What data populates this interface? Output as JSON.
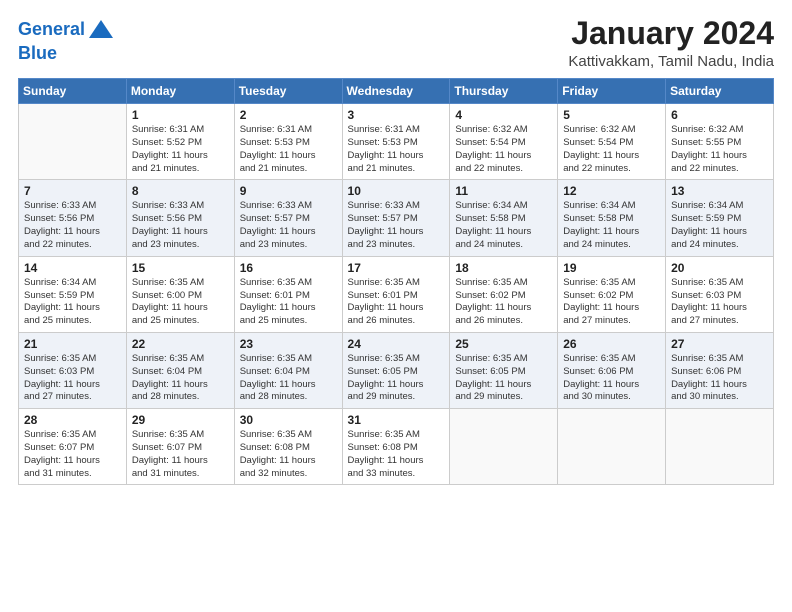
{
  "header": {
    "logo_line1": "General",
    "logo_line2": "Blue",
    "month": "January 2024",
    "location": "Kattivakkam, Tamil Nadu, India"
  },
  "weekdays": [
    "Sunday",
    "Monday",
    "Tuesday",
    "Wednesday",
    "Thursday",
    "Friday",
    "Saturday"
  ],
  "weeks": [
    [
      {
        "day": "",
        "info": ""
      },
      {
        "day": "1",
        "info": "Sunrise: 6:31 AM\nSunset: 5:52 PM\nDaylight: 11 hours\nand 21 minutes."
      },
      {
        "day": "2",
        "info": "Sunrise: 6:31 AM\nSunset: 5:53 PM\nDaylight: 11 hours\nand 21 minutes."
      },
      {
        "day": "3",
        "info": "Sunrise: 6:31 AM\nSunset: 5:53 PM\nDaylight: 11 hours\nand 21 minutes."
      },
      {
        "day": "4",
        "info": "Sunrise: 6:32 AM\nSunset: 5:54 PM\nDaylight: 11 hours\nand 22 minutes."
      },
      {
        "day": "5",
        "info": "Sunrise: 6:32 AM\nSunset: 5:54 PM\nDaylight: 11 hours\nand 22 minutes."
      },
      {
        "day": "6",
        "info": "Sunrise: 6:32 AM\nSunset: 5:55 PM\nDaylight: 11 hours\nand 22 minutes."
      }
    ],
    [
      {
        "day": "7",
        "info": "Sunrise: 6:33 AM\nSunset: 5:56 PM\nDaylight: 11 hours\nand 22 minutes."
      },
      {
        "day": "8",
        "info": "Sunrise: 6:33 AM\nSunset: 5:56 PM\nDaylight: 11 hours\nand 23 minutes."
      },
      {
        "day": "9",
        "info": "Sunrise: 6:33 AM\nSunset: 5:57 PM\nDaylight: 11 hours\nand 23 minutes."
      },
      {
        "day": "10",
        "info": "Sunrise: 6:33 AM\nSunset: 5:57 PM\nDaylight: 11 hours\nand 23 minutes."
      },
      {
        "day": "11",
        "info": "Sunrise: 6:34 AM\nSunset: 5:58 PM\nDaylight: 11 hours\nand 24 minutes."
      },
      {
        "day": "12",
        "info": "Sunrise: 6:34 AM\nSunset: 5:58 PM\nDaylight: 11 hours\nand 24 minutes."
      },
      {
        "day": "13",
        "info": "Sunrise: 6:34 AM\nSunset: 5:59 PM\nDaylight: 11 hours\nand 24 minutes."
      }
    ],
    [
      {
        "day": "14",
        "info": "Sunrise: 6:34 AM\nSunset: 5:59 PM\nDaylight: 11 hours\nand 25 minutes."
      },
      {
        "day": "15",
        "info": "Sunrise: 6:35 AM\nSunset: 6:00 PM\nDaylight: 11 hours\nand 25 minutes."
      },
      {
        "day": "16",
        "info": "Sunrise: 6:35 AM\nSunset: 6:01 PM\nDaylight: 11 hours\nand 25 minutes."
      },
      {
        "day": "17",
        "info": "Sunrise: 6:35 AM\nSunset: 6:01 PM\nDaylight: 11 hours\nand 26 minutes."
      },
      {
        "day": "18",
        "info": "Sunrise: 6:35 AM\nSunset: 6:02 PM\nDaylight: 11 hours\nand 26 minutes."
      },
      {
        "day": "19",
        "info": "Sunrise: 6:35 AM\nSunset: 6:02 PM\nDaylight: 11 hours\nand 27 minutes."
      },
      {
        "day": "20",
        "info": "Sunrise: 6:35 AM\nSunset: 6:03 PM\nDaylight: 11 hours\nand 27 minutes."
      }
    ],
    [
      {
        "day": "21",
        "info": "Sunrise: 6:35 AM\nSunset: 6:03 PM\nDaylight: 11 hours\nand 27 minutes."
      },
      {
        "day": "22",
        "info": "Sunrise: 6:35 AM\nSunset: 6:04 PM\nDaylight: 11 hours\nand 28 minutes."
      },
      {
        "day": "23",
        "info": "Sunrise: 6:35 AM\nSunset: 6:04 PM\nDaylight: 11 hours\nand 28 minutes."
      },
      {
        "day": "24",
        "info": "Sunrise: 6:35 AM\nSunset: 6:05 PM\nDaylight: 11 hours\nand 29 minutes."
      },
      {
        "day": "25",
        "info": "Sunrise: 6:35 AM\nSunset: 6:05 PM\nDaylight: 11 hours\nand 29 minutes."
      },
      {
        "day": "26",
        "info": "Sunrise: 6:35 AM\nSunset: 6:06 PM\nDaylight: 11 hours\nand 30 minutes."
      },
      {
        "day": "27",
        "info": "Sunrise: 6:35 AM\nSunset: 6:06 PM\nDaylight: 11 hours\nand 30 minutes."
      }
    ],
    [
      {
        "day": "28",
        "info": "Sunrise: 6:35 AM\nSunset: 6:07 PM\nDaylight: 11 hours\nand 31 minutes."
      },
      {
        "day": "29",
        "info": "Sunrise: 6:35 AM\nSunset: 6:07 PM\nDaylight: 11 hours\nand 31 minutes."
      },
      {
        "day": "30",
        "info": "Sunrise: 6:35 AM\nSunset: 6:08 PM\nDaylight: 11 hours\nand 32 minutes."
      },
      {
        "day": "31",
        "info": "Sunrise: 6:35 AM\nSunset: 6:08 PM\nDaylight: 11 hours\nand 33 minutes."
      },
      {
        "day": "",
        "info": ""
      },
      {
        "day": "",
        "info": ""
      },
      {
        "day": "",
        "info": ""
      }
    ]
  ]
}
